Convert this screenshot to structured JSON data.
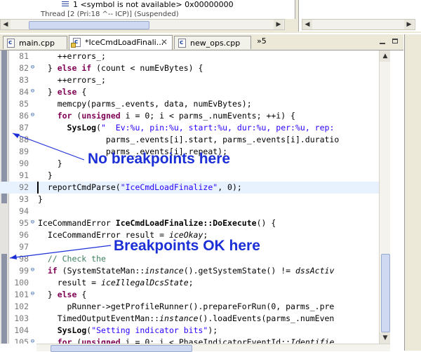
{
  "debug_tree": {
    "row1": "1 <symbol is not available> 0x00000000",
    "row2": "Thread [2 (Pri:18 ^-- ICP)] (Suspended)"
  },
  "tabs": [
    {
      "label": "main.cpp",
      "active": false
    },
    {
      "label": "*IceCmdLoadFinali...",
      "active": true,
      "close": "✕"
    },
    {
      "label": "new_ops.cpp",
      "active": false
    }
  ],
  "tab_overflow": "»5",
  "editor": {
    "lines": [
      {
        "n": "81",
        "fold": "",
        "parts": [
          [
            "",
            "    ++errors_;"
          ]
        ]
      },
      {
        "n": "82",
        "fold": "⊖",
        "parts": [
          [
            "",
            "  } "
          ],
          [
            "kw",
            "else if"
          ],
          [
            "",
            " (count < numEvBytes) {"
          ]
        ]
      },
      {
        "n": "83",
        "fold": "",
        "parts": [
          [
            "",
            "    ++errors_;"
          ]
        ]
      },
      {
        "n": "84",
        "fold": "⊖",
        "parts": [
          [
            "",
            "  } "
          ],
          [
            "kw",
            "else"
          ],
          [
            "",
            " {"
          ]
        ]
      },
      {
        "n": "85",
        "fold": "",
        "parts": [
          [
            "",
            "    memcpy(parms_.events, data, numEvBytes);"
          ]
        ]
      },
      {
        "n": "86",
        "fold": "⊖",
        "parts": [
          [
            "",
            "    "
          ],
          [
            "kw",
            "for"
          ],
          [
            "",
            " ("
          ],
          [
            "kw",
            "unsigned"
          ],
          [
            "",
            " i = 0; i < parms_.numEvents; ++i) {"
          ]
        ]
      },
      {
        "n": "87",
        "fold": "",
        "parts": [
          [
            "",
            "      "
          ],
          [
            "bold",
            "SysLog"
          ],
          [
            "",
            "("
          ],
          [
            "str",
            "\"  Ev:%u, pin:%u, start:%u, dur:%u, per:%u, rep:"
          ]
        ]
      },
      {
        "n": "88",
        "fold": "",
        "parts": [
          [
            "",
            "              parms_.events[i].start, parms_.events[i].duratio"
          ]
        ]
      },
      {
        "n": "89",
        "fold": "",
        "parts": [
          [
            "",
            "              parms_.events[i].repeat);"
          ]
        ]
      },
      {
        "n": "90",
        "fold": "",
        "parts": [
          [
            "",
            "    }"
          ]
        ]
      },
      {
        "n": "91",
        "fold": "",
        "parts": [
          [
            "",
            "  }"
          ]
        ]
      },
      {
        "n": "92",
        "fold": "",
        "cur": true,
        "parts": [
          [
            "",
            "  reportCmdParse("
          ],
          [
            "str",
            "\"IceCmdLoadFinalize\""
          ],
          [
            "",
            ", 0);"
          ]
        ]
      },
      {
        "n": "93",
        "fold": "",
        "parts": [
          [
            "",
            "}"
          ]
        ]
      },
      {
        "n": "94",
        "fold": "",
        "parts": [
          [
            "",
            ""
          ]
        ]
      },
      {
        "n": "95",
        "fold": "⊖",
        "parts": [
          [
            "",
            "IceCommandError "
          ],
          [
            "bold",
            "IceCmdLoadFinalize::DoExecute"
          ],
          [
            "",
            "() {"
          ]
        ]
      },
      {
        "n": "96",
        "fold": "",
        "parts": [
          [
            "",
            "  IceCommandError result = "
          ],
          [
            "ital",
            "iceOkay"
          ],
          [
            "",
            ";"
          ]
        ]
      },
      {
        "n": "97",
        "fold": "",
        "parts": [
          [
            "",
            ""
          ]
        ]
      },
      {
        "n": "98",
        "fold": "",
        "parts": [
          [
            "cmt",
            "  // Check the"
          ]
        ]
      },
      {
        "n": "99",
        "fold": "⊖",
        "parts": [
          [
            "",
            "  "
          ],
          [
            "kw",
            "if"
          ],
          [
            "",
            " (SystemStateMan::"
          ],
          [
            "ital",
            "instance"
          ],
          [
            "",
            "().getSystemState() != "
          ],
          [
            "ital",
            "dssActiv"
          ]
        ]
      },
      {
        "n": "100",
        "fold": "",
        "parts": [
          [
            "",
            "    result = "
          ],
          [
            "ital",
            "iceIllegalDcsState"
          ],
          [
            "",
            ";"
          ]
        ]
      },
      {
        "n": "101",
        "fold": "⊖",
        "parts": [
          [
            "",
            "  } "
          ],
          [
            "kw",
            "else"
          ],
          [
            "",
            " {"
          ]
        ]
      },
      {
        "n": "102",
        "fold": "",
        "parts": [
          [
            "",
            "      pRunner->getProfileRunner().prepareForRun(0, parms_.pre"
          ]
        ]
      },
      {
        "n": "103",
        "fold": "",
        "parts": [
          [
            "",
            "    TimedOutputEventMan::"
          ],
          [
            "ital",
            "instance"
          ],
          [
            "",
            "().loadEvents(parms_.numEven"
          ]
        ]
      },
      {
        "n": "104",
        "fold": "",
        "parts": [
          [
            "",
            "    "
          ],
          [
            "bold",
            "SysLog"
          ],
          [
            "",
            "("
          ],
          [
            "str",
            "\"Setting indicator bits\""
          ],
          [
            "",
            ");"
          ]
        ]
      },
      {
        "n": "105",
        "fold": "⊖",
        "parts": [
          [
            "",
            "    "
          ],
          [
            "kw",
            "for"
          ],
          [
            "",
            " ("
          ],
          [
            "kw",
            "unsigned"
          ],
          [
            "",
            " i = 0; i < PhaseIndicatorEventId::"
          ],
          [
            "ital",
            "Identifie"
          ]
        ]
      }
    ]
  },
  "annotations": {
    "no_breakpoints": "No breakpoints here",
    "breakpoints_ok": "Breakpoints OK here"
  },
  "colors": {
    "keyword": "#7f0055",
    "string": "#2a00ff",
    "comment": "#3f7f5f",
    "annotation": "#1c2fd6"
  }
}
